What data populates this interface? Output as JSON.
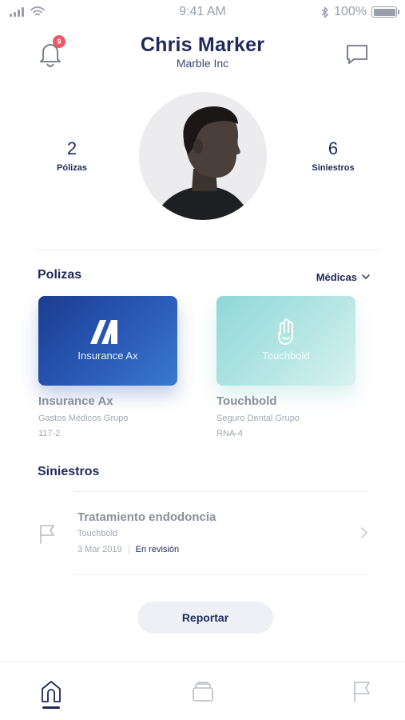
{
  "status_bar": {
    "time": "9:41 AM",
    "battery_label": "100%",
    "battery_level": 1.0
  },
  "header": {
    "name": "Chris Marker",
    "company": "Marble Inc",
    "notification_count": "9"
  },
  "stats": {
    "polizas_count": "2",
    "polizas_label": "Pólizas",
    "siniestros_count": "6",
    "siniestros_label": "Siniestros"
  },
  "polizas_section": {
    "title": "Polizas",
    "filter_label": "Médicas",
    "cards": [
      {
        "caption": "Insurance Ax",
        "name": "Insurance Ax",
        "type": "Gastos Médicos Grupo",
        "number": "117-2",
        "color": "#2a5ab8"
      },
      {
        "caption": "Touchbold",
        "name": "Touchbold",
        "type": "Seguro Dental Grupo",
        "number": "RNA-4",
        "color": "#a8e2e0"
      }
    ]
  },
  "siniestros_section": {
    "title": "Siniestros",
    "claims": [
      {
        "title": "Tratamiento endodoncia",
        "provider": "Touchbold",
        "date": "3 Mar 2019",
        "status": "En revisión"
      }
    ]
  },
  "report_button": "Reportar",
  "tabbar": {
    "tabs": [
      {
        "icon": "home-icon",
        "active": true
      },
      {
        "icon": "card-stack-icon",
        "active": false
      },
      {
        "icon": "flag-icon",
        "active": false
      }
    ]
  },
  "colors": {
    "primary": "#1f2a5a",
    "badge": "#ef5666",
    "muted": "#8b8f9a"
  }
}
